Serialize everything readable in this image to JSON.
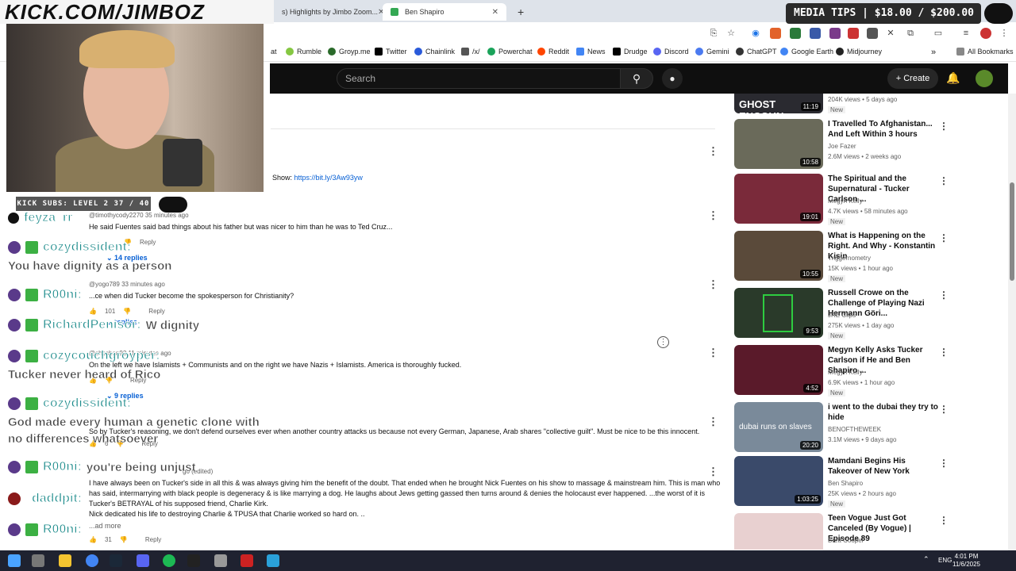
{
  "overlay": {
    "kick_url": "KICK.COM/JIMBOZ",
    "kick_subs": "KICK SUBS: LEVEL 2 37 / 40",
    "media_tips": "MEDIA TIPS | $18.00 / $200.00"
  },
  "tabs": [
    {
      "label": "s) Highlights by Jimbo Zoom..."
    },
    {
      "label": "Ben Shapiro"
    }
  ],
  "bookmarks": [
    {
      "label": "at"
    },
    {
      "label": "Rumble"
    },
    {
      "label": "Groyp.me"
    },
    {
      "label": "Twitter"
    },
    {
      "label": "Chainlink"
    },
    {
      "label": "/x/"
    },
    {
      "label": "Powerchat"
    },
    {
      "label": "Reddit"
    },
    {
      "label": "News"
    },
    {
      "label": "Drudge"
    },
    {
      "label": "Discord"
    },
    {
      "label": "Gemini"
    },
    {
      "label": "ChatGPT"
    },
    {
      "label": "Google Earth"
    },
    {
      "label": "Midjourney"
    },
    {
      "label": "All Bookmarks"
    }
  ],
  "youtube": {
    "search_placeholder": "Search",
    "create_label": "Create"
  },
  "description": {
    "show_label": "Show:",
    "link": "https://bit.ly/3Aw93yw"
  },
  "comments": [
    {
      "author": "@timothycody2270",
      "time": "35 minutes ago",
      "text": "He said Fuentes said bad things about his father but was nicer to him than he was to Ted Cruz...",
      "likes": "",
      "replies": "14 replies"
    },
    {
      "author": "@yogo789",
      "time": "33 minutes ago",
      "text": "...ce when did Tucker become the spokesperson for Christianity?",
      "likes": "101",
      "replies": "replies"
    },
    {
      "author": "@shoshan93",
      "time": "11 minutes ago",
      "text": "On the left we have Islamists + Communists and on the right we have Nazis + Islamists. America is thoroughly fucked.",
      "likes": "",
      "replies": "9 replies"
    },
    {
      "author": "",
      "time": "",
      "text": "So by Tucker's reasoning, we don't defend ourselves ever when another country attacks us because not every German, Japanese, Arab shares \"collective guilt\". Must be nice to be this innocent.",
      "likes": "6",
      "replies": ""
    },
    {
      "author": "",
      "time": "go (edited)",
      "text": "I have always been on Tucker's side in all this & was always giving him the benefit of the doubt. That ended when he brought Nick Fuentes on his show to massage & mainstream him. This is man who has said, intermarrying with black people is degeneracy & is like marrying a dog. He laughs about Jews getting gassed then turns around & denies the holocaust ever happened. ...the worst of it is Tucker's BETRAYAL of his supposed friend, Charlie Kirk.",
      "text2": "Nick dedicated his life to destroying Charlie & TPUSA that Charlie worked so hard on. ..",
      "more": "...ad more",
      "likes": "31",
      "replies": ""
    }
  ],
  "reply_label": "Reply",
  "chat": [
    {
      "name": "feyza_rr",
      "msg": ""
    },
    {
      "name": "cozydissident:",
      "msg": ""
    },
    {
      "name": "",
      "msg": "You have dignity as a person"
    },
    {
      "name": "R00ni:",
      "msg": ""
    },
    {
      "name": "RichardPenisor:",
      "msg": "W dignity"
    },
    {
      "name": "cozycouchgroyper:",
      "msg": ""
    },
    {
      "name": "",
      "msg": "Tucker never heard of Rico"
    },
    {
      "name": "cozydissident:",
      "msg": ""
    },
    {
      "name": "",
      "msg": "God made every human a genetic clone with"
    },
    {
      "name": "",
      "msg": "no differences whatsoever"
    },
    {
      "name": "R00ni:",
      "msg": "you're being unjust"
    },
    {
      "name": "daddpit:",
      "msg": ""
    },
    {
      "name": "R00ni:",
      "msg": ""
    }
  ],
  "videos": [
    {
      "title": "",
      "thumb_text": "GHOST ENCOUN",
      "duration": "11:19",
      "channel": "",
      "meta": "204K views • 5 days ago",
      "new": "New",
      "thumb_color": "#2a2a30"
    },
    {
      "title": "I Travelled To Afghanistan... And Left Within 3 hours",
      "duration": "10:58",
      "channel": "Joe Fazer",
      "meta": "2.6M views • 2 weeks ago",
      "new": "",
      "thumb_color": "#6a6a5a"
    },
    {
      "title": "The Spiritual and the Supernatural - Tucker Carlson ...",
      "duration": "19:01",
      "channel": "Megyn Kelly",
      "meta": "4.7K views • 58 minutes ago",
      "new": "New",
      "thumb_color": "#7a2a3a"
    },
    {
      "title": "What is Happening on the Right. And Why - Konstantin Kisin",
      "duration": "10:55",
      "channel": "Triggernometry",
      "meta": "15K views • 1 hour ago",
      "new": "New",
      "thumb_color": "#5a4a3a"
    },
    {
      "title": "Russell Crowe on the Challenge of Playing Nazi Hermann Göri...",
      "duration": "9:53",
      "channel": "JRE Clips",
      "meta": "275K views • 1 day ago",
      "new": "New",
      "thumb_color": "#2a3a2a"
    },
    {
      "title": "Megyn Kelly Asks Tucker Carlson if He and Ben Shapiro ...",
      "duration": "4:52",
      "channel": "Megyn Kelly",
      "meta": "6.9K views • 1 hour ago",
      "new": "New",
      "thumb_color": "#5a1a2a"
    },
    {
      "title": "i went to the dubai they try to hide",
      "thumb_text": "dubai runs on slaves",
      "duration": "20:20",
      "channel": "BENOFTHEWEEK",
      "meta": "3.1M views • 9 days ago",
      "new": "",
      "thumb_color": "#7a8a9a"
    },
    {
      "title": "Mamdani Begins His Takeover of New York",
      "duration": "1:03:25",
      "channel": "Ben Shapiro",
      "meta": "25K views • 2 hours ago",
      "new": "New",
      "thumb_color": "#3a4a6a"
    },
    {
      "title": "Teen Vogue Just Got Canceled (By Vogue) | Episode 89",
      "duration": "",
      "channel": "Brett Cooper",
      "meta": "",
      "new": "",
      "thumb_color": "#e8d0d0"
    }
  ],
  "taskbar": {
    "lang": "ENG",
    "time": "4:01 PM",
    "date": "11/6/2025"
  }
}
